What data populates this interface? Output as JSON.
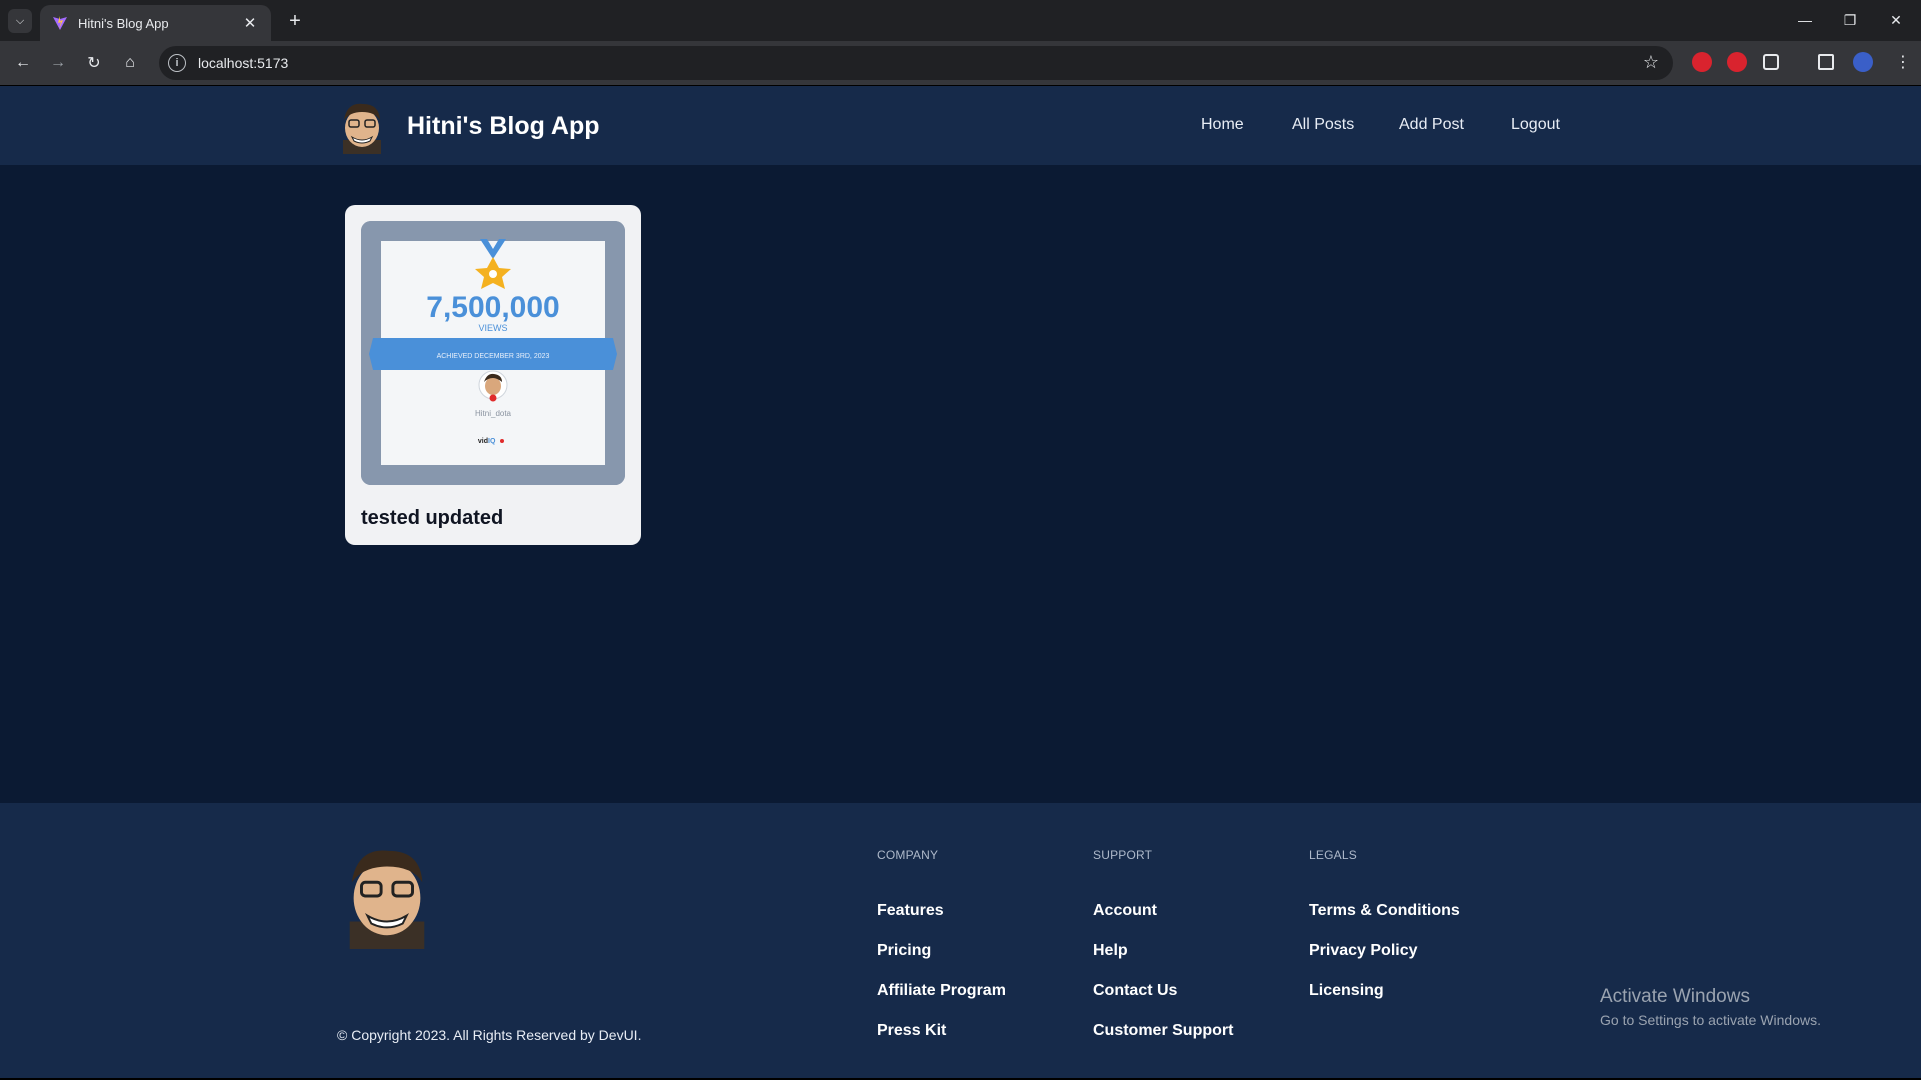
{
  "browser": {
    "tab_title": "Hitni's Blog App",
    "url": "localhost:5173"
  },
  "header": {
    "brand": "Hitni's Blog App",
    "nav": [
      "Home",
      "All Posts",
      "Add Post",
      "Logout"
    ]
  },
  "posts": [
    {
      "title": "tested updated",
      "image": {
        "number": "7,500,000",
        "unit": "VIEWS",
        "ribbon": "ACHIEVED DECEMBER 3RD, 2023",
        "channel": "Hitni_dota",
        "brand_a": "vid",
        "brand_b": "IQ"
      }
    }
  ],
  "footer": {
    "columns": [
      {
        "heading": "COMPANY",
        "links": [
          "Features",
          "Pricing",
          "Affiliate Program",
          "Press Kit"
        ]
      },
      {
        "heading": "SUPPORT",
        "links": [
          "Account",
          "Help",
          "Contact Us",
          "Customer Support"
        ]
      },
      {
        "heading": "LEGALS",
        "links": [
          "Terms & Conditions",
          "Privacy Policy",
          "Licensing"
        ]
      }
    ],
    "copyright": "© Copyright 2023. All Rights Reserved by DevUI."
  },
  "watermark": {
    "title": "Activate Windows",
    "subtitle": "Go to Settings to activate Windows."
  },
  "colors": {
    "page_bg": "#0b1a33",
    "header_bg": "#162a4a",
    "card_bg": "#f1f2f4",
    "accent_blue": "#4a90d9"
  }
}
